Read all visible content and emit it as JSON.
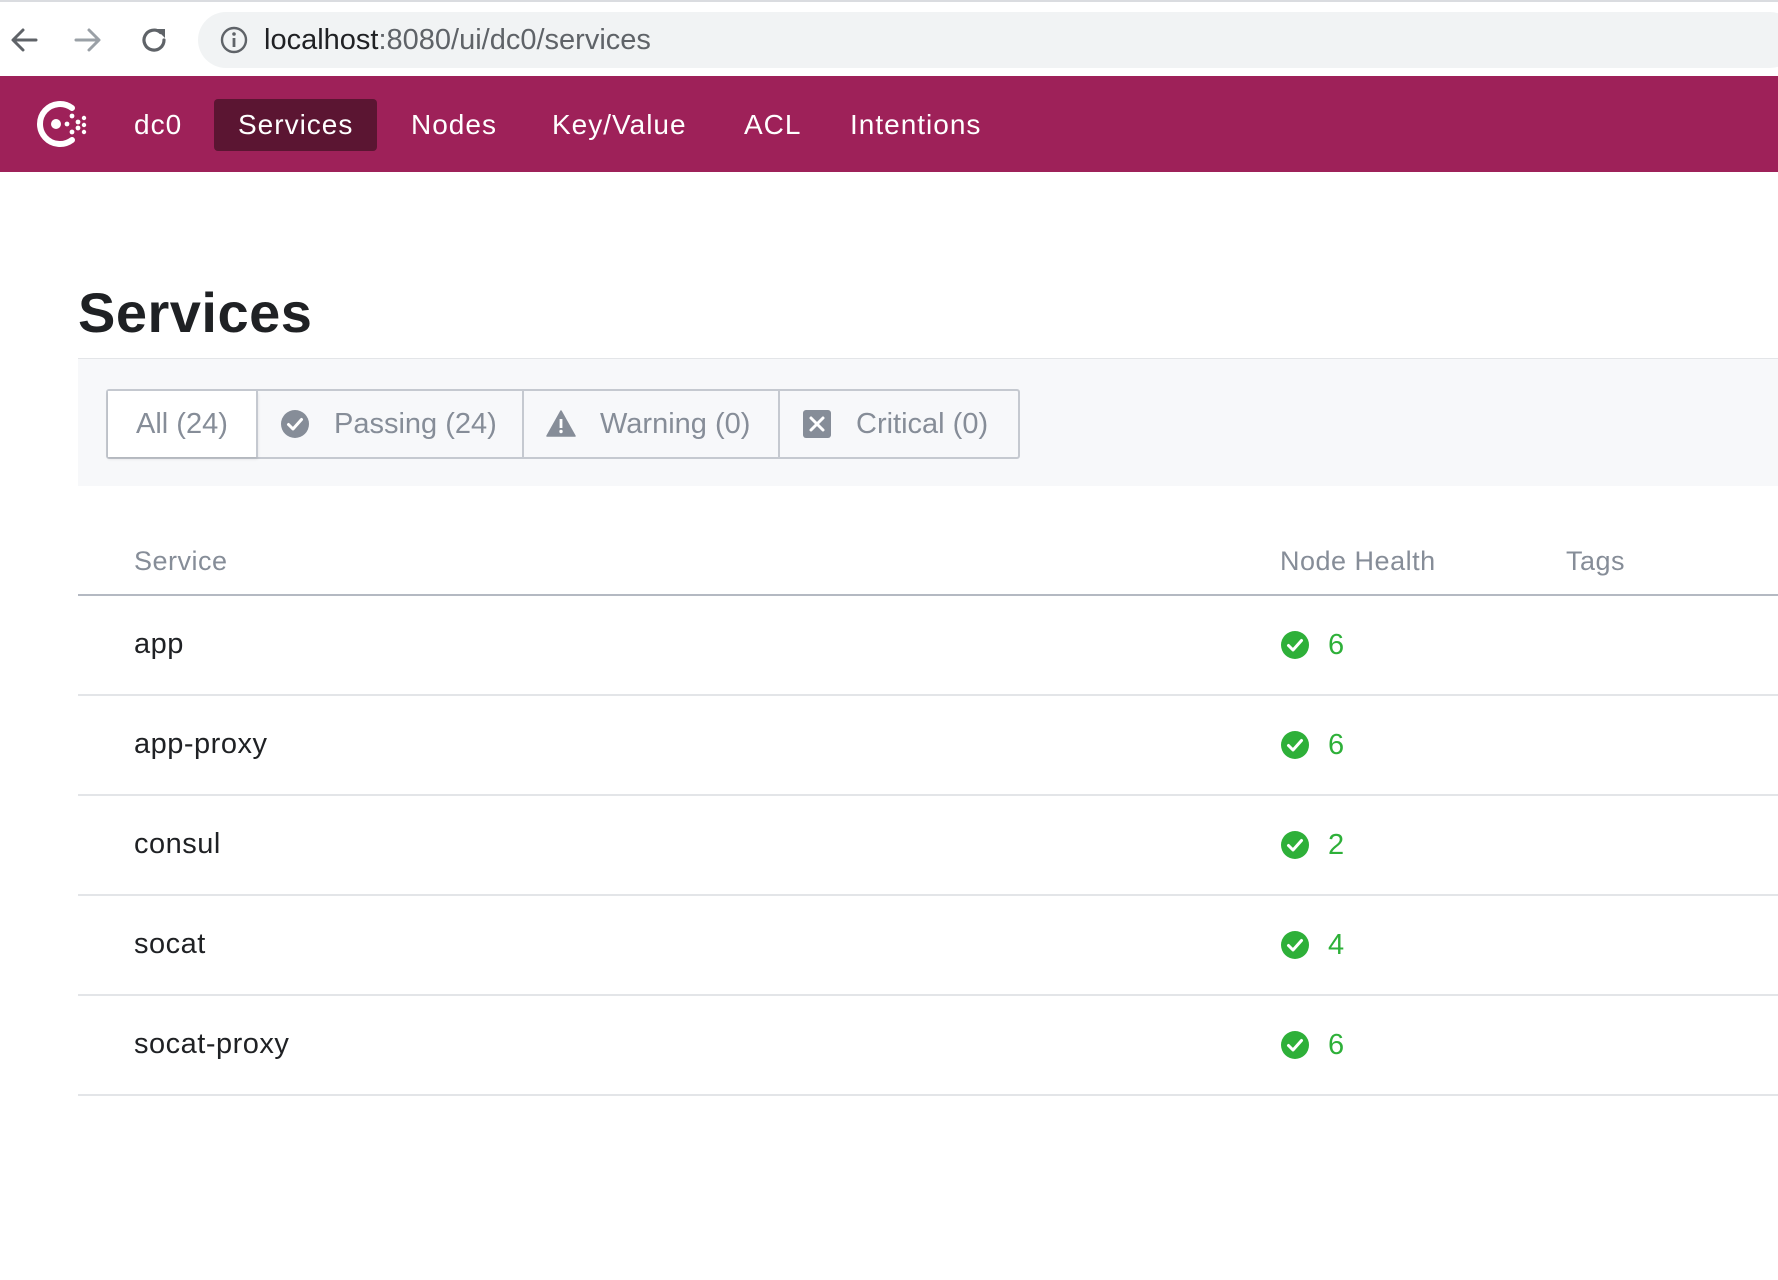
{
  "browser": {
    "url_host": "localhost",
    "url_rest": ":8080/ui/dc0/services"
  },
  "nav": {
    "datacenter": "dc0",
    "items": [
      {
        "label": "Services",
        "active": true
      },
      {
        "label": "Nodes",
        "active": false
      },
      {
        "label": "Key/Value",
        "active": false
      },
      {
        "label": "ACL",
        "active": false
      },
      {
        "label": "Intentions",
        "active": false
      }
    ]
  },
  "page": {
    "title": "Services"
  },
  "filters": {
    "all": "All (24)",
    "passing": "Passing (24)",
    "warning": "Warning (0)",
    "critical": "Critical (0)",
    "selected": "all"
  },
  "table": {
    "columns": [
      "Service",
      "Node Health",
      "Tags"
    ],
    "rows": [
      {
        "service": "app",
        "health": "6",
        "tags": ""
      },
      {
        "service": "app-proxy",
        "health": "6",
        "tags": ""
      },
      {
        "service": "consul",
        "health": "2",
        "tags": ""
      },
      {
        "service": "socat",
        "health": "4",
        "tags": ""
      },
      {
        "service": "socat-proxy",
        "health": "6",
        "tags": ""
      }
    ]
  },
  "colors": {
    "brand": "#9e2159",
    "brand_active": "#5b1532",
    "passing": "#2eb039",
    "muted": "#868d98"
  },
  "icons": {
    "back": "back-arrow-icon",
    "forward": "forward-arrow-icon",
    "reload": "reload-icon",
    "site_info": "info-icon",
    "logo": "consul-logo-icon",
    "passing": "check-circle-icon",
    "warning": "warning-triangle-icon",
    "critical": "critical-x-icon"
  }
}
